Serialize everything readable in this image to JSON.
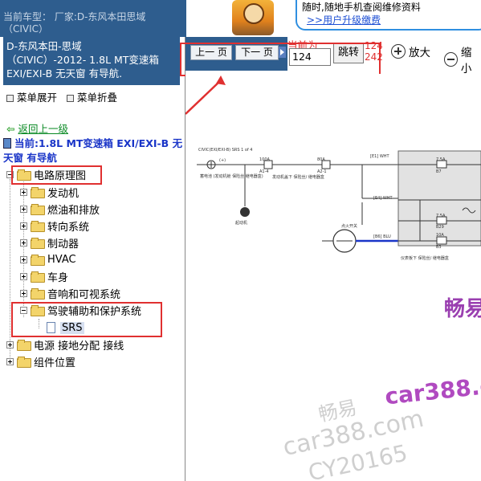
{
  "header": {
    "vehicle_label": "当前车型： 厂家:D-东风本田思域（CIVIC）",
    "year": "2012"
  },
  "ad": {
    "line1": "随时,随地手机查阅维修资料",
    "line2": ">>用户升级缴费"
  },
  "info_panel": {
    "lines": [
      "D-东风本田-思域",
      "（CIVIC）-2012- 1.8L MT变速箱",
      "EXI/EXI-B 无天窗 有导航."
    ]
  },
  "menu": {
    "expand": "菜单展开",
    "collapse": "菜单折叠"
  },
  "nav": {
    "back": "返回上一级",
    "current": "当前:1.8L MT变速箱 EXI/EXI-B 无天窗 有导航"
  },
  "tree": {
    "root": "电路原理图",
    "children": [
      "发动机",
      "燃油和排放",
      "转向系统",
      "制动器",
      "HVAC",
      "车身",
      "音响和可视系统"
    ],
    "expanded": "驾驶辅助和保护系统",
    "leaf": "SRS",
    "others": [
      "电源 接地分配 接线",
      "组件位置"
    ]
  },
  "toolbar": {
    "prev": "上一 页",
    "next": "下一 页",
    "current_label": "当前为",
    "page_value": "124",
    "jump": "跳转",
    "page_current": "124",
    "page_total": "242",
    "zoom_in": "放大",
    "zoom_out": "缩小"
  },
  "diagram": {
    "title": "CIVIC(EXI/EXI-B) SRS 1 of 4",
    "fuse_labels": [
      "100A",
      "A1-4",
      "80A",
      "A2-1",
      "7.5A",
      "B7",
      "7.5A",
      "B29",
      "10A",
      "B3"
    ],
    "wire_labels": [
      "(+)",
      "[E1] WHT",
      "[E1] WHT",
      "[E4] WHT",
      "[E4] WHT",
      "[B6] WHT",
      "[B6] BLU"
    ],
    "component_labels": [
      "发动机盖下 保险丝/ 继电器盒",
      "点火开关",
      "仪表板下 保险丝/ 继电器盒",
      "起动机",
      "蓄电池 (发动机舱 保险丝 继电器盒)"
    ],
    "watermarks": [
      "畅易",
      "car388.com",
      "畅易",
      "car388.com",
      "CY20165"
    ]
  },
  "colors": {
    "panel_blue": "#2e5d8e",
    "highlight_red": "#e03030",
    "link_green": "#0a8a24",
    "current_blue": "#1a35c8",
    "watermark_purple": "#9a3fb0"
  }
}
